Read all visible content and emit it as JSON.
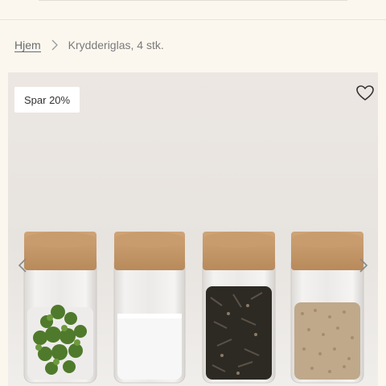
{
  "breadcrumb": {
    "home_label": "Hjem",
    "current_label": "Krydderiglas, 4 stk."
  },
  "gallery": {
    "badge": "Spar 20%",
    "icons": {
      "favorite": "heart-icon",
      "prev": "chevron-left-icon",
      "next": "chevron-right-icon",
      "separator": "chevron-right-icon"
    }
  },
  "colors": {
    "page_bg": "#fbf7ef",
    "photo_bg": "#ebe6e1",
    "cork": "#c79b6c",
    "text": "#5c5c5c"
  }
}
